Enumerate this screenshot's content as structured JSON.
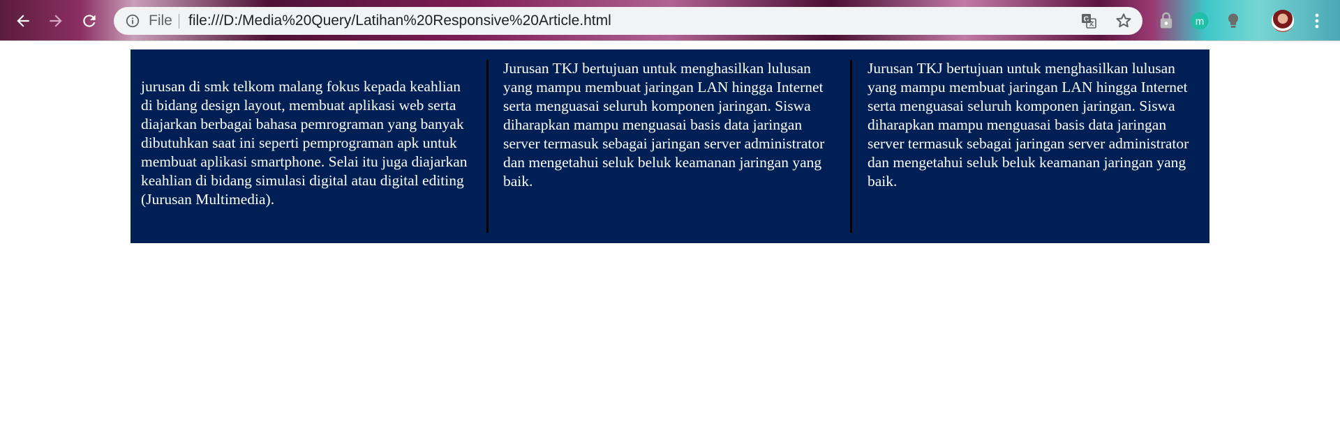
{
  "browser": {
    "scheme_label": "File",
    "url": "file:///D:/Media%20Query/Latihan%20Responsive%20Article.html"
  },
  "icons": {
    "back": "arrow-left-icon",
    "forward": "arrow-right-icon",
    "reload": "reload-icon",
    "info": "info-icon",
    "translate": "translate-icon",
    "bookmark": "star-icon",
    "menu": "kebab-menu-icon"
  },
  "colors": {
    "article_background": "#001f54",
    "article_text": "#ffffff",
    "column_rule": "#000000"
  },
  "article": {
    "columns": [
      "jurusan di smk telkom malang fokus kepada keahlian di bidang design layout, membuat aplikasi web serta diajarkan berbagai bahasa pemrograman yang banyak dibutuhkan saat ini seperti pemprograman apk untuk membuat aplikasi smartphone. Selai itu juga diajarkan keahlian di bidang simulasi digital atau digital editing (Jurusan Multimedia).",
      "Jurusan TKJ bertujuan untuk menghasilkan lulusan yang mampu membuat jaringan LAN hingga Internet serta menguasai seluruh komponen jaringan. Siswa diharapkan mampu menguasai basis data jaringan server termasuk sebagai jaringan server administrator dan mengetahui seluk beluk keamanan jaringan yang baik.",
      "Jurusan TKJ bertujuan untuk menghasilkan lulusan yang mampu membuat jaringan LAN hingga Internet serta menguasai seluruh komponen jaringan. Siswa diharapkan mampu menguasai basis data jaringan server termasuk sebagai jaringan server administrator dan mengetahui seluk beluk keamanan jaringan yang baik."
    ]
  }
}
